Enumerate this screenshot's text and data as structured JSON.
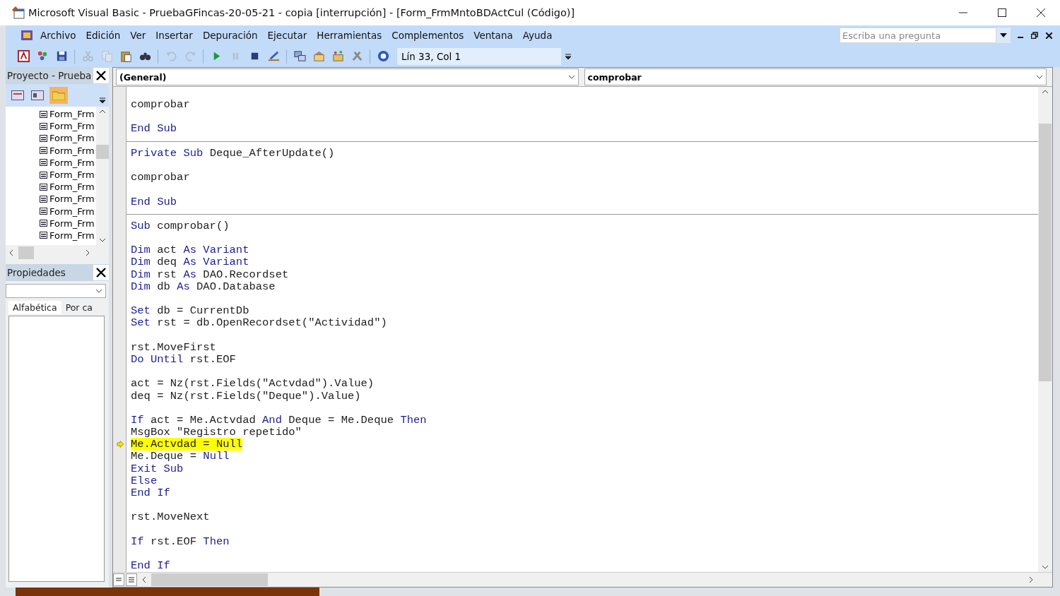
{
  "window": {
    "title": "Microsoft Visual Basic - PruebaGFincas-20-05-21 - copia [interrupción] - [Form_FrmMntoBDActCul (Código)]"
  },
  "menu": [
    "Archivo",
    "Edición",
    "Ver",
    "Insertar",
    "Depuración",
    "Ejecutar",
    "Herramientas",
    "Complementos",
    "Ventana",
    "Ayuda"
  ],
  "help_search": {
    "placeholder": "Escriba una pregunta"
  },
  "toolbar": [
    {
      "kind": "access",
      "disabled": false
    },
    {
      "kind": "insert",
      "disabled": false
    },
    {
      "kind": "save",
      "disabled": false
    },
    {
      "kind": "separator"
    },
    {
      "kind": "cut",
      "disabled": true
    },
    {
      "kind": "copy",
      "disabled": true
    },
    {
      "kind": "paste",
      "disabled": false
    },
    {
      "kind": "find",
      "disabled": false
    },
    {
      "kind": "separator"
    },
    {
      "kind": "undo",
      "disabled": true
    },
    {
      "kind": "redo",
      "disabled": true
    },
    {
      "kind": "separator"
    },
    {
      "kind": "run",
      "disabled": false
    },
    {
      "kind": "pause",
      "disabled": true
    },
    {
      "kind": "stop",
      "disabled": false
    },
    {
      "kind": "design",
      "disabled": false
    },
    {
      "kind": "separator"
    },
    {
      "kind": "project",
      "disabled": false
    },
    {
      "kind": "properties",
      "disabled": false
    },
    {
      "kind": "browser",
      "disabled": false
    },
    {
      "kind": "toolbox",
      "disabled": false
    },
    {
      "kind": "separator"
    },
    {
      "kind": "help",
      "disabled": false
    }
  ],
  "position": "Lín 33, Col 1",
  "project_panel": {
    "title": "Proyecto - Prueba",
    "items": [
      "Form_Frm",
      "Form_Frm",
      "Form_Frm",
      "Form_Frm",
      "Form_Frm",
      "Form_Frm",
      "Form_Frm",
      "Form_Frm",
      "Form_Frm",
      "Form_Frm",
      "Form_Frm"
    ]
  },
  "properties_panel": {
    "title": "Propiedades",
    "tabs": [
      {
        "label": "Alfabética",
        "selected": true
      },
      {
        "label": "Por ca",
        "selected": false
      }
    ]
  },
  "code_window": {
    "object": "(General)",
    "procedure": "comprobar",
    "procedures": [
      {
        "blocks": [
          [
            {
              "current": false,
              "tokens": [
                {
                  "text": "comprobar",
                  "kind": "plain"
                }
              ]
            }
          ],
          [
            {
              "current": false,
              "tokens": [
                {
                  "text": "End Sub",
                  "kind": "keyword"
                }
              ]
            }
          ]
        ]
      },
      {
        "blocks": [
          [
            {
              "current": false,
              "tokens": [
                {
                  "text": "Private Sub",
                  "kind": "keyword"
                },
                {
                  "text": " Deque_AfterUpdate()",
                  "kind": "plain"
                }
              ]
            }
          ],
          [
            {
              "current": false,
              "tokens": [
                {
                  "text": "comprobar",
                  "kind": "plain"
                }
              ]
            }
          ],
          [
            {
              "current": false,
              "tokens": [
                {
                  "text": "End Sub",
                  "kind": "keyword"
                }
              ]
            }
          ]
        ]
      },
      {
        "blocks": [
          [
            {
              "current": false,
              "tokens": [
                {
                  "text": "Sub",
                  "kind": "keyword"
                },
                {
                  "text": " comprobar()",
                  "kind": "plain"
                }
              ]
            }
          ],
          [
            {
              "current": false,
              "tokens": [
                {
                  "text": "Dim",
                  "kind": "keyword"
                },
                {
                  "text": " act ",
                  "kind": "plain"
                },
                {
                  "text": "As Variant",
                  "kind": "keyword"
                }
              ]
            },
            {
              "current": false,
              "tokens": [
                {
                  "text": "Dim",
                  "kind": "keyword"
                },
                {
                  "text": " deq ",
                  "kind": "plain"
                },
                {
                  "text": "As Variant",
                  "kind": "keyword"
                }
              ]
            },
            {
              "current": false,
              "tokens": [
                {
                  "text": "Dim",
                  "kind": "keyword"
                },
                {
                  "text": " rst ",
                  "kind": "plain"
                },
                {
                  "text": "As",
                  "kind": "keyword"
                },
                {
                  "text": " DAO.Recordset",
                  "kind": "plain"
                }
              ]
            },
            {
              "current": false,
              "tokens": [
                {
                  "text": "Dim",
                  "kind": "keyword"
                },
                {
                  "text": " db ",
                  "kind": "plain"
                },
                {
                  "text": "As",
                  "kind": "keyword"
                },
                {
                  "text": " DAO.Database",
                  "kind": "plain"
                }
              ]
            }
          ],
          [
            {
              "current": false,
              "tokens": [
                {
                  "text": "Set",
                  "kind": "keyword"
                },
                {
                  "text": " db = CurrentDb",
                  "kind": "plain"
                }
              ]
            },
            {
              "current": false,
              "tokens": [
                {
                  "text": "Set",
                  "kind": "keyword"
                },
                {
                  "text": " rst = db.OpenRecordset(\"Actividad\")",
                  "kind": "plain"
                }
              ]
            }
          ],
          [
            {
              "current": false,
              "tokens": [
                {
                  "text": "rst.MoveFirst",
                  "kind": "plain"
                }
              ]
            },
            {
              "current": false,
              "tokens": [
                {
                  "text": "Do Until",
                  "kind": "keyword"
                },
                {
                  "text": " rst.EOF",
                  "kind": "plain"
                }
              ]
            }
          ],
          [
            {
              "current": false,
              "tokens": [
                {
                  "text": "act = Nz(rst.Fields(\"Actvdad\").Value)",
                  "kind": "plain"
                }
              ]
            },
            {
              "current": false,
              "tokens": [
                {
                  "text": "deq = Nz(rst.Fields(\"Deque\").Value)",
                  "kind": "plain"
                }
              ]
            }
          ],
          [
            {
              "current": false,
              "tokens": [
                {
                  "text": "If",
                  "kind": "keyword"
                },
                {
                  "text": " act = Me.Actvdad ",
                  "kind": "plain"
                },
                {
                  "text": "And",
                  "kind": "keyword"
                },
                {
                  "text": " Deque = Me.Deque ",
                  "kind": "plain"
                },
                {
                  "text": "Then",
                  "kind": "keyword"
                }
              ]
            },
            {
              "current": false,
              "tokens": [
                {
                  "text": "MsgBox \"Registro repetido\"",
                  "kind": "plain"
                }
              ]
            },
            {
              "current": true,
              "tokens": [
                {
                  "text": "Me.Actvdad = ",
                  "kind": "plain"
                },
                {
                  "text": "Null",
                  "kind": "keyword"
                }
              ]
            },
            {
              "current": false,
              "tokens": [
                {
                  "text": "Me.Deque = ",
                  "kind": "plain"
                },
                {
                  "text": "Null",
                  "kind": "keyword"
                }
              ]
            },
            {
              "current": false,
              "tokens": [
                {
                  "text": "Exit Sub",
                  "kind": "keyword"
                }
              ]
            },
            {
              "current": false,
              "tokens": [
                {
                  "text": "Else",
                  "kind": "keyword"
                }
              ]
            },
            {
              "current": false,
              "tokens": [
                {
                  "text": "End If",
                  "kind": "keyword"
                }
              ]
            }
          ],
          [
            {
              "current": false,
              "tokens": [
                {
                  "text": "rst.MoveNext",
                  "kind": "plain"
                }
              ]
            }
          ],
          [
            {
              "current": false,
              "tokens": [
                {
                  "text": "If",
                  "kind": "keyword"
                },
                {
                  "text": " rst.EOF ",
                  "kind": "plain"
                },
                {
                  "text": "Then",
                  "kind": "keyword"
                }
              ]
            }
          ],
          [
            {
              "current": false,
              "tokens": [
                {
                  "text": "End If",
                  "kind": "keyword"
                }
              ]
            }
          ]
        ]
      }
    ]
  }
}
